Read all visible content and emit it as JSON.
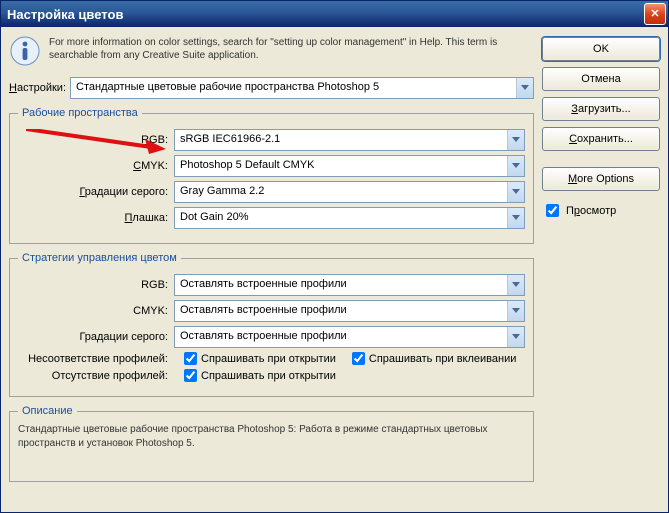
{
  "window": {
    "title": "Настройка цветов"
  },
  "info": {
    "text": "For more information on color settings, search for \"setting up color management\" in Help. This term is searchable from any Creative Suite application."
  },
  "settings": {
    "label": "Настройки:",
    "value": "Стандартные цветовые рабочие пространства Photoshop 5"
  },
  "workspaces": {
    "legend": "Рабочие пространства",
    "rgb_label": "RGB:",
    "rgb_value": "sRGB IEC61966-2.1",
    "cmyk_label": "CMYK:",
    "cmyk_value": "Photoshop 5 Default CMYK",
    "gray_label": "Градации серого:",
    "gray_value": "Gray Gamma 2.2",
    "spot_label": "Плашка:",
    "spot_value": "Dot Gain 20%"
  },
  "policies": {
    "legend": "Стратегии управления цветом",
    "rgb_label": "RGB:",
    "rgb_value": "Оставлять встроенные профили",
    "cmyk_label": "CMYK:",
    "cmyk_value": "Оставлять встроенные профили",
    "gray_label": "Градации серого:",
    "gray_value": "Оставлять встроенные профили",
    "mismatch_label": "Несоответствие профилей:",
    "mismatch_open": "Спрашивать при открытии",
    "mismatch_paste": "Спрашивать при вклеивании",
    "missing_label": "Отсутствие профилей:",
    "missing_open": "Спрашивать при открытии"
  },
  "description": {
    "legend": "Описание",
    "body": "Стандартные цветовые рабочие пространства Photoshop 5: Работа в режиме стандартных цветовых пространств и установок Photoshop 5."
  },
  "buttons": {
    "ok": "OK",
    "cancel": "Отмена",
    "load": "Загрузить...",
    "save": "Сохранить...",
    "more": "More Options",
    "preview": "Просмотр"
  }
}
